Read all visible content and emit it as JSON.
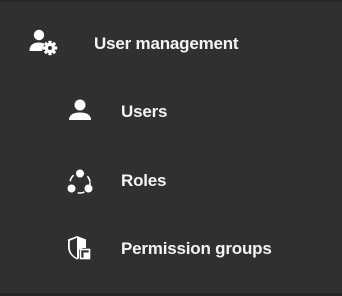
{
  "menu": {
    "parent": {
      "label": "User management",
      "icon": "user-management-gear-icon"
    },
    "items": [
      {
        "label": "Users",
        "icon": "user-icon"
      },
      {
        "label": "Roles",
        "icon": "roles-icon"
      },
      {
        "label": "Permission groups",
        "icon": "permission-groups-shield-icon"
      }
    ]
  },
  "colors": {
    "background": "#303030",
    "outer": "#262626",
    "text": "#f4f4f4",
    "icon": "#ffffff"
  }
}
